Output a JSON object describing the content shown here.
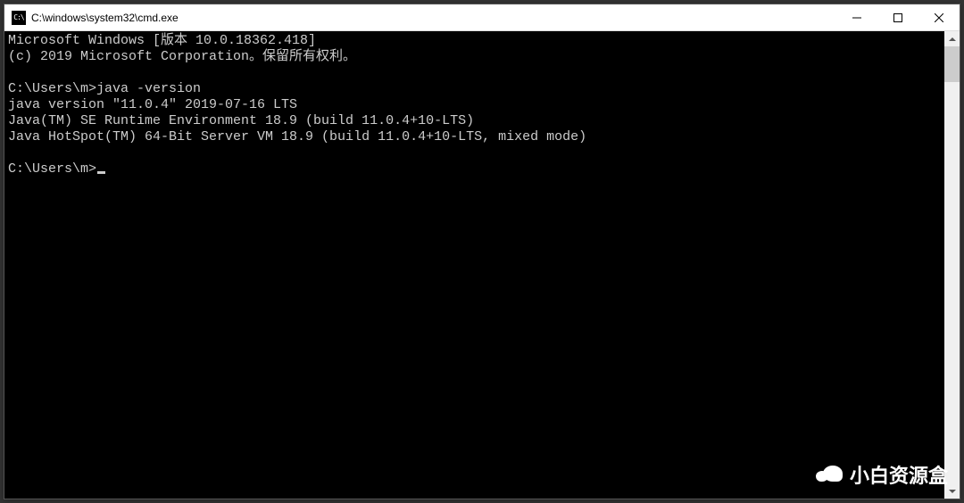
{
  "window": {
    "icon_text": "C:\\",
    "title": "C:\\windows\\system32\\cmd.exe"
  },
  "terminal": {
    "lines": [
      "Microsoft Windows [版本 10.0.18362.418]",
      "(c) 2019 Microsoft Corporation。保留所有权利。",
      "",
      "C:\\Users\\m>java -version",
      "java version \"11.0.4\" 2019-07-16 LTS",
      "Java(TM) SE Runtime Environment 18.9 (build 11.0.4+10-LTS)",
      "Java HotSpot(TM) 64-Bit Server VM 18.9 (build 11.0.4+10-LTS, mixed mode)",
      ""
    ],
    "prompt": "C:\\Users\\m>"
  },
  "watermark": {
    "text": "小白资源盒"
  }
}
